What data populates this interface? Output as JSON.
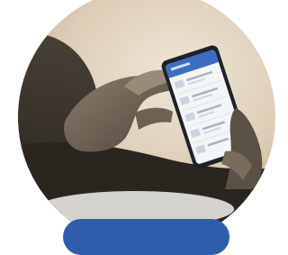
{
  "photo": {
    "subject": "hands-holding-smartphone",
    "colors": {
      "background_warm": "#e9dcc9",
      "shadow": "#2b2620",
      "phone_header": "#3d6cc2",
      "phone_screen": "#f4f5f7"
    }
  },
  "cta": {
    "color": "#2f5dab"
  }
}
